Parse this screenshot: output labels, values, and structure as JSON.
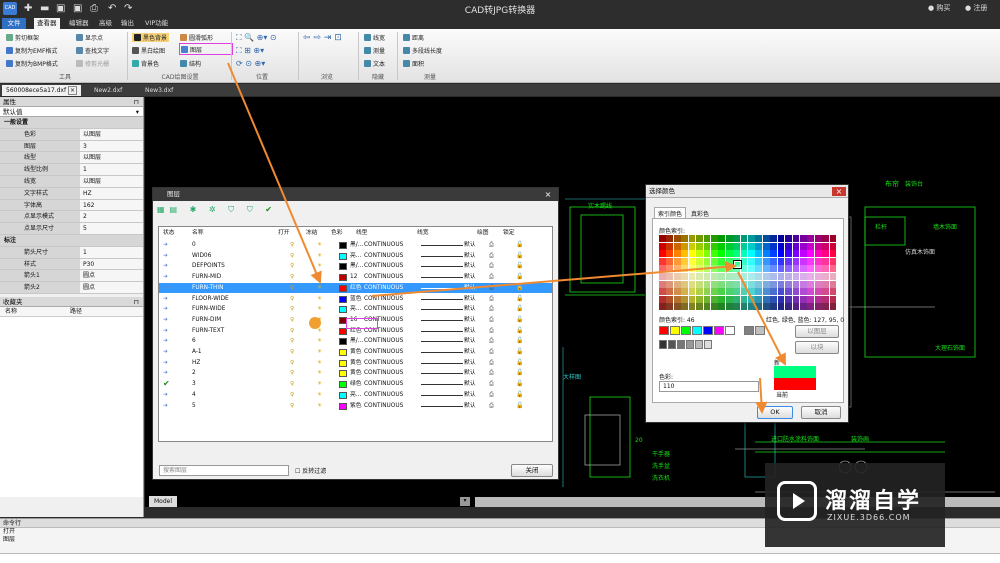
{
  "app": {
    "title": "CAD转JPG转换器",
    "buy": "购买",
    "register": "注册"
  },
  "menu": {
    "file": "文件",
    "tabs": [
      "查看器",
      "编辑器",
      "高级",
      "输出",
      "VIP功能"
    ]
  },
  "ribbon": {
    "tools": [
      "剪切框架",
      "复制为EMF格式",
      "复制为BMP格式",
      "显示点",
      "查找文字",
      "修剪光栅"
    ],
    "cad": [
      "黑色背景",
      "黑白绘图",
      "背景色",
      "圆滑弧形",
      "图层",
      "结构"
    ],
    "hide": [
      "线宽",
      "测量",
      "文本"
    ],
    "measure": [
      "距离",
      "多段线长度",
      "面积"
    ],
    "groups": {
      "tools": "工具",
      "cad": "CAD绘图设置",
      "position": "位置",
      "browse": "浏览",
      "hide": "隐藏",
      "measure": "测量"
    }
  },
  "doctabs": [
    "560008ece5a17.dxf",
    "New2.dxf",
    "New3.dxf"
  ],
  "props": {
    "title": "属性",
    "default": "默认值",
    "rows": [
      {
        "k": "一般设置",
        "v": "",
        "sec": true
      },
      {
        "k": "色彩",
        "v": "以图层"
      },
      {
        "k": "图层",
        "v": "3"
      },
      {
        "k": "线型",
        "v": "以图层"
      },
      {
        "k": "线型比例",
        "v": "1"
      },
      {
        "k": "线宽",
        "v": "以图层"
      },
      {
        "k": "文字样式",
        "v": "HZ"
      },
      {
        "k": "字体高",
        "v": "162"
      },
      {
        "k": "点显示模式",
        "v": "2"
      },
      {
        "k": "点显示尺寸",
        "v": "5"
      },
      {
        "k": "标注",
        "v": "",
        "sec": true
      },
      {
        "k": "箭头尺寸",
        "v": "1"
      },
      {
        "k": "样式",
        "v": "P30"
      },
      {
        "k": "箭头1",
        "v": "圆点"
      },
      {
        "k": "箭头2",
        "v": "圆点"
      }
    ],
    "fav": "收藏夹",
    "favcols": [
      "名称",
      "路径"
    ]
  },
  "layerDialog": {
    "title": "图层",
    "headers": [
      "状态",
      "名称",
      "打开",
      "冻结",
      "色彩",
      "线型",
      "线宽",
      "绘图",
      "锁定"
    ],
    "rows": [
      {
        "name": "0",
        "color": "黑/...",
        "hex": "#000000",
        "ltype": "CONTINUOUS",
        "lw": "默认"
      },
      {
        "name": "WID06",
        "color": "亮...",
        "hex": "#00ffff",
        "ltype": "CONTINUOUS",
        "lw": "默认"
      },
      {
        "name": "DEFPOINTS",
        "color": "黑/...",
        "hex": "#000000",
        "ltype": "CONTINUOUS",
        "lw": "默认"
      },
      {
        "name": "FURN-MID",
        "color": "12",
        "hex": "#c00000",
        "ltype": "CONTINUOUS",
        "lw": "默认"
      },
      {
        "name": "FURN-THIN",
        "color": "红色",
        "hex": "#ff0000",
        "ltype": "CONTINUOUS",
        "lw": "默认",
        "sel": true
      },
      {
        "name": "FLOOR-WIDE",
        "color": "蓝色",
        "hex": "#0000ff",
        "ltype": "CONTINUOUS",
        "lw": "默认"
      },
      {
        "name": "FURN-WIDE",
        "color": "亮...",
        "hex": "#00ffff",
        "ltype": "CONTINUOUS",
        "lw": "默认"
      },
      {
        "name": "FURN-DIM",
        "color": "16",
        "hex": "#800000",
        "ltype": "CONTINUOUS",
        "lw": "默认"
      },
      {
        "name": "FURN-TEXT",
        "color": "红色",
        "hex": "#ff0000",
        "ltype": "CONTINUOUS",
        "lw": "默认"
      },
      {
        "name": "6",
        "color": "黑/...",
        "hex": "#000000",
        "ltype": "CONTINUOUS",
        "lw": "默认"
      },
      {
        "name": "A-1",
        "color": "黄色",
        "hex": "#ffff00",
        "ltype": "CONTINUOUS",
        "lw": "默认"
      },
      {
        "name": "HZ",
        "color": "黄色",
        "hex": "#ffff00",
        "ltype": "CONTINUOUS",
        "lw": "默认"
      },
      {
        "name": "2",
        "color": "黄色",
        "hex": "#ffff00",
        "ltype": "CONTINUOUS",
        "lw": "默认"
      },
      {
        "name": "3",
        "color": "绿色",
        "hex": "#00ff00",
        "ltype": "CONTINUOUS",
        "lw": "默认",
        "check": true
      },
      {
        "name": "4",
        "color": "亮...",
        "hex": "#00ffff",
        "ltype": "CONTINUOUS",
        "lw": "默认"
      },
      {
        "name": "5",
        "color": "紫色",
        "hex": "#ff00ff",
        "ltype": "CONTINUOUS",
        "lw": "默认"
      }
    ],
    "search": "搜索图层",
    "reverse": "反转过滤",
    "close": "关闭"
  },
  "colorDialog": {
    "title": "选择颜色",
    "tabs": [
      "索引颜色",
      "真彩色"
    ],
    "indexLabel": "颜色索引:",
    "info1": "颜色索引: 46",
    "info2": "红色, 绿色, 蓝色: 127, 95, 0",
    "bylayer": "以图层",
    "byblock": "以块",
    "new": "新",
    "current": "当前",
    "colorLabel": "色彩:",
    "colorValue": "110",
    "ok": "OK",
    "cancel": "取消"
  },
  "canvasText": [
    "实木踢线",
    "布帘",
    "装饰台",
    "栏杆",
    "墙木饰面",
    "大理石饰面",
    "进口防水涂料饰面",
    "装饰画",
    "干手器",
    "洗衣机",
    "20",
    "洗手盆",
    "大样图",
    "仿真木饰面"
  ],
  "cmd": {
    "label": "命令行",
    "lines": [
      "打开",
      "图层"
    ]
  },
  "model": "Model",
  "watermark": {
    "brand": "溜溜自学",
    "url": "ZIXUE.3D66.COM"
  }
}
